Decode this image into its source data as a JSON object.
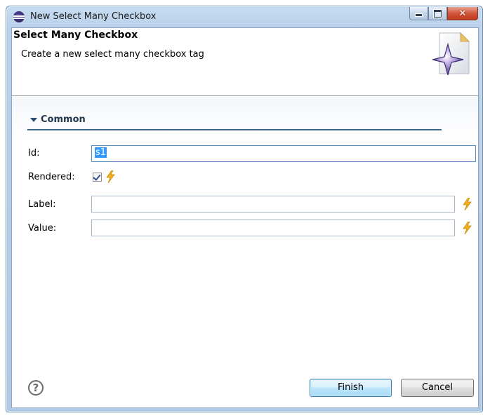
{
  "window": {
    "title": "New Select Many Checkbox",
    "icon": "eclipse-icon",
    "controls": [
      "minimize",
      "maximize",
      "close"
    ]
  },
  "banner": {
    "title": "Select Many Checkbox",
    "description": "Create a new select many checkbox tag",
    "image": "wizard-star-icon"
  },
  "section": {
    "title": "Common",
    "expanded": true
  },
  "form": {
    "id_label": "Id:",
    "id_value": "s1",
    "rendered_label": "Rendered:",
    "rendered_checked": true,
    "label_label": "Label:",
    "label_value": "",
    "value_label": "Value:",
    "value_value": ""
  },
  "buttons": {
    "finish": "Finish",
    "cancel": "Cancel",
    "help_icon": "?"
  },
  "colors": {
    "section_accent": "#3f6587",
    "bolt": "#f2b11d",
    "selection": "#3399ff",
    "close_button": "#c0391c"
  }
}
